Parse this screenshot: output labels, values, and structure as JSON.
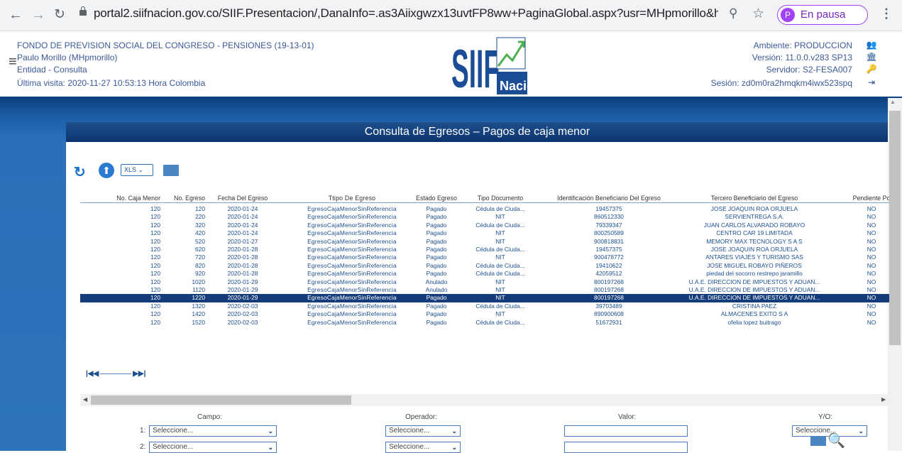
{
  "browser": {
    "url": "portal2.siifnacion.gov.co/SIIF.Presentacion/,DanaInfo=.as3Aiixgwzx13uvtFP8ww+PaginaGlobal.aspx?usr=MHpmorillo&h...",
    "profile_initial": "P",
    "profile_status": "En pausa"
  },
  "header": {
    "entity": "FONDO DE PREVISION SOCIAL DEL CONGRESO - PENSIONES (19-13-01)",
    "user": "Paulo Morillo (MHpmorillo)",
    "role": "Entidad - Consulta",
    "last_visit": "Última visita: 2020-11-27 10:53:13 Hora Colombia",
    "environment": "Ambiente: PRODUCCION",
    "version": "Versión: 11.0.0.v283 SP13",
    "server": "Servidor: S2-FESA007",
    "session": "Sesión: zd0m0ra2hmqkm4iwx523spq",
    "logo_text": "SIIF",
    "logo_sub": "Nación"
  },
  "page": {
    "title": "Consulta de Egresos – Pagos de caja menor",
    "format": "XLS"
  },
  "table": {
    "columns": [
      "No. Caja Menor",
      "No. Egreso",
      "Fecha Del Egreso",
      "Ttipo De Egreso",
      "Estado Egreso",
      "Tipo Documento",
      "Identificación Beneficiario Del Egreso",
      "Tercero Beneficiario del Egreso",
      "Pendiente Po"
    ],
    "rows": [
      [
        "120",
        "120",
        "2020-01-24",
        "EgresoCajaMenorSinReferencia",
        "Pagado",
        "Cédula de Ciuda...",
        "19457375",
        "JOSE JOAQUIN ROA ORJUELA",
        "NO"
      ],
      [
        "120",
        "220",
        "2020-01-24",
        "EgresoCajaMenorSinReferencia",
        "Pagado",
        "NIT",
        "860512330",
        "SERVIENTREGA S.A.",
        "NO"
      ],
      [
        "120",
        "320",
        "2020-01-24",
        "EgresoCajaMenorSinReferencia",
        "Pagado",
        "Cédula de Ciuda...",
        "79339347",
        "JUAN CARLOS ALVARADO ROBAYO",
        "NO"
      ],
      [
        "120",
        "420",
        "2020-01-24",
        "EgresoCajaMenorSinReferencia",
        "Pagado",
        "NIT",
        "800250589",
        "CENTRO CAR 19 LIMITADA",
        "NO"
      ],
      [
        "120",
        "520",
        "2020-01-27",
        "EgresoCajaMenorSinReferencia",
        "Pagado",
        "NIT",
        "900818831",
        "MEMORY MAX TECNOLOGY S A S",
        "NO"
      ],
      [
        "120",
        "620",
        "2020-01-28",
        "EgresoCajaMenorSinReferencia",
        "Pagado",
        "Cédula de Ciuda...",
        "19457375",
        "JOSE JOAQUIN ROA ORJUELA",
        "NO"
      ],
      [
        "120",
        "720",
        "2020-01-28",
        "EgresoCajaMenorSinReferencia",
        "Pagado",
        "NIT",
        "900478772",
        "ANTARES VIAJES Y TURISMO SAS",
        "NO"
      ],
      [
        "120",
        "820",
        "2020-01-28",
        "EgresoCajaMenorSinReferencia",
        "Pagado",
        "Cédula de Ciuda...",
        "19410622",
        "JOSE MIGUEL ROBAYO PIÑEROS",
        "NO"
      ],
      [
        "120",
        "920",
        "2020-01-28",
        "EgresoCajaMenorSinReferencia",
        "Pagado",
        "Cédula de Ciuda...",
        "42059512",
        "piedad del socorro restrepo jaramillo",
        "NO"
      ],
      [
        "120",
        "1020",
        "2020-01-29",
        "EgresoCajaMenorSinReferencia",
        "Anulado",
        "NIT",
        "800197268",
        "U.A.E. DIRECCION DE IMPUESTOS Y ADUAN...",
        "NO"
      ],
      [
        "120",
        "1120",
        "2020-01-29",
        "EgresoCajaMenorSinReferencia",
        "Anulado",
        "NIT",
        "800197268",
        "U.A.E. DIRECCION DE IMPUESTOS Y ADUAN...",
        "NO"
      ],
      [
        "120",
        "1220",
        "2020-01-29",
        "EgresoCajaMenorSinReferencia",
        "Pagado",
        "NIT",
        "800197268",
        "U.A.E. DIRECCION DE IMPUESTOS Y ADUAN...",
        "NO"
      ],
      [
        "120",
        "1320",
        "2020-02-03",
        "EgresoCajaMenorSinReferencia",
        "Pagado",
        "Cédula de Ciuda...",
        "39703489",
        "CRISTINA PAEZ",
        "NO"
      ],
      [
        "120",
        "1420",
        "2020-02-03",
        "EgresoCajaMenorSinReferencia",
        "Pagado",
        "NIT",
        "890900608",
        "ALMACENES EXITO S A",
        "NO"
      ],
      [
        "120",
        "1520",
        "2020-02-03",
        "EgresoCajaMenorSinReferencia",
        "Pagado",
        "Cédula de Ciuda...",
        "51672931",
        "ofelia lopez buitrago",
        "NO"
      ]
    ],
    "selected_row": 11
  },
  "filters": {
    "campo_label": "Campo:",
    "operador_label": "Operador:",
    "valor_label": "Valor:",
    "yo_label": "Y/O:",
    "row1_num": "1:",
    "row2_num": "2:",
    "placeholder": "Seleccione..."
  },
  "colors": {
    "header_blue": "#0b3470",
    "selected_row": "#153c7a",
    "text_blue": "#1d4f91"
  }
}
